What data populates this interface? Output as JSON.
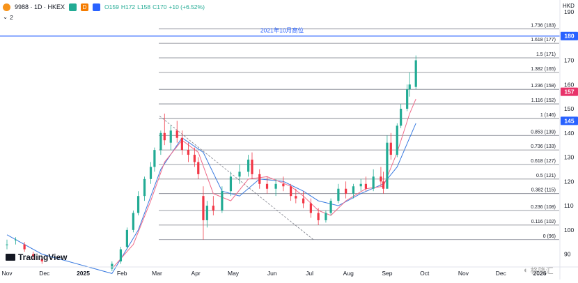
{
  "header": {
    "symbol": "9988 · 1D · HKEX",
    "badge_d": "D",
    "ohlc": [
      "O159",
      "H172",
      "L158",
      "C170"
    ],
    "change": "+10 (+6.52%)",
    "layers": "2",
    "currency": "HKD",
    "chevron": "chevron-down-icon"
  },
  "watermark": "TradingView",
  "watermark_secondary": "格隆汇",
  "colors": {
    "up": "#22ab94",
    "down": "#f23645",
    "ma_fast": "#f06b8a",
    "ma_slow": "#3a7be0",
    "fib": "#787b86",
    "resistance": "#2962ff",
    "label_157": "#e8336a",
    "label_145": "#2962ff"
  },
  "chart_data": {
    "type": "candlestick",
    "y_axis": {
      "min": 85,
      "max": 192,
      "ticks": [
        90,
        100,
        110,
        120,
        130,
        140,
        150,
        160,
        170,
        180,
        190
      ]
    },
    "x_axis_labels": [
      "Nov",
      "Dec",
      "2025",
      "Feb",
      "Mar",
      "Apr",
      "May",
      "Jun",
      "Jul",
      "Aug",
      "Sep",
      "Oct",
      "Nov",
      "Dec",
      "2026"
    ],
    "fibonacci": [
      {
        "ratio": "0",
        "price": 96
      },
      {
        "ratio": "0.116",
        "price": 102
      },
      {
        "ratio": "0.236",
        "price": 108
      },
      {
        "ratio": "0.382",
        "price": 115
      },
      {
        "ratio": "0.5",
        "price": 121
      },
      {
        "ratio": "0.618",
        "price": 127
      },
      {
        "ratio": "0.736",
        "price": 133
      },
      {
        "ratio": "0.853",
        "price": 139
      },
      {
        "ratio": "1",
        "price": 146
      },
      {
        "ratio": "1.116",
        "price": 152
      },
      {
        "ratio": "1.236",
        "price": 158
      },
      {
        "ratio": "1.382",
        "price": 165
      },
      {
        "ratio": "1.5",
        "price": 171
      },
      {
        "ratio": "1.618",
        "price": 177
      },
      {
        "ratio": "1.736",
        "price": 183
      }
    ],
    "resistance": {
      "price": 180,
      "label": "2021年10月高位"
    },
    "price_labels": [
      {
        "price": 180,
        "text": "180"
      },
      {
        "price": 157,
        "text": "157"
      },
      {
        "price": 145,
        "text": "145"
      }
    ],
    "trendline": {
      "from": [
        "2025-03-03",
        147
      ],
      "to": [
        "2025-07-04",
        96
      ]
    },
    "candles": [
      [
        "2024-11-01",
        94,
        96,
        92,
        94
      ],
      [
        "2024-11-08",
        96,
        97,
        94,
        96
      ],
      [
        "2024-11-15",
        94,
        95,
        91,
        92
      ],
      [
        "2024-11-22",
        90,
        91,
        88,
        89
      ],
      [
        "2024-11-29",
        88,
        89,
        86,
        87
      ],
      [
        "2025-01-24",
        84,
        87,
        83,
        86
      ],
      [
        "2025-01-31",
        87,
        93,
        86,
        92
      ],
      [
        "2025-02-05",
        93,
        101,
        92,
        100
      ],
      [
        "2025-02-10",
        100,
        108,
        99,
        107
      ],
      [
        "2025-02-14",
        107,
        116,
        106,
        114
      ],
      [
        "2025-02-19",
        114,
        122,
        112,
        121
      ],
      [
        "2025-02-24",
        121,
        128,
        119,
        126
      ],
      [
        "2025-02-27",
        126,
        134,
        124,
        133
      ],
      [
        "2025-03-04",
        133,
        141,
        131,
        140
      ],
      [
        "2025-03-07",
        140,
        148,
        135,
        137
      ],
      [
        "2025-03-12",
        136,
        143,
        133,
        141
      ],
      [
        "2025-03-17",
        141,
        145,
        136,
        138
      ],
      [
        "2025-03-21",
        138,
        141,
        131,
        133
      ],
      [
        "2025-03-26",
        133,
        136,
        128,
        131
      ],
      [
        "2025-03-31",
        131,
        134,
        126,
        128
      ],
      [
        "2025-04-03",
        128,
        130,
        121,
        123
      ],
      [
        "2025-04-07",
        114,
        118,
        96,
        104
      ],
      [
        "2025-04-10",
        104,
        112,
        101,
        110
      ],
      [
        "2025-04-15",
        110,
        114,
        106,
        108
      ],
      [
        "2025-04-22",
        108,
        118,
        107,
        116
      ],
      [
        "2025-04-29",
        116,
        124,
        114,
        122
      ],
      [
        "2025-05-06",
        122,
        127,
        119,
        124
      ],
      [
        "2025-05-13",
        124,
        131,
        122,
        129
      ],
      [
        "2025-05-16",
        129,
        132,
        121,
        123
      ],
      [
        "2025-05-22",
        123,
        125,
        117,
        119
      ],
      [
        "2025-05-28",
        119,
        122,
        115,
        117
      ],
      [
        "2025-06-04",
        117,
        121,
        114,
        119
      ],
      [
        "2025-06-10",
        119,
        122,
        116,
        118
      ],
      [
        "2025-06-16",
        118,
        119,
        112,
        114
      ],
      [
        "2025-06-20",
        114,
        117,
        111,
        113
      ],
      [
        "2025-06-26",
        113,
        116,
        109,
        111
      ],
      [
        "2025-07-02",
        111,
        113,
        105,
        107
      ],
      [
        "2025-07-08",
        107,
        109,
        102,
        104
      ],
      [
        "2025-07-14",
        104,
        108,
        103,
        107
      ],
      [
        "2025-07-18",
        107,
        113,
        106,
        112
      ],
      [
        "2025-07-24",
        112,
        119,
        111,
        117
      ],
      [
        "2025-07-30",
        117,
        120,
        113,
        115
      ],
      [
        "2025-08-05",
        115,
        119,
        113,
        118
      ],
      [
        "2025-08-11",
        118,
        121,
        116,
        119
      ],
      [
        "2025-08-15",
        119,
        122,
        116,
        117
      ],
      [
        "2025-08-21",
        117,
        125,
        116,
        122
      ],
      [
        "2025-08-27",
        122,
        126,
        118,
        120
      ],
      [
        "2025-08-29",
        120,
        124,
        115,
        117
      ],
      [
        "2025-09-01",
        117,
        139,
        117,
        136
      ],
      [
        "2025-09-04",
        136,
        140,
        129,
        131
      ],
      [
        "2025-09-09",
        131,
        144,
        130,
        143
      ],
      [
        "2025-09-12",
        143,
        152,
        142,
        150
      ],
      [
        "2025-09-17",
        150,
        160,
        149,
        158
      ],
      [
        "2025-09-19",
        158,
        165,
        155,
        160
      ],
      [
        "2025-09-24",
        159,
        172,
        158,
        170
      ]
    ],
    "ma_fast": [
      [
        "2025-01-24",
        84
      ],
      [
        "2025-02-10",
        94
      ],
      [
        "2025-02-24",
        112
      ],
      [
        "2025-03-07",
        128
      ],
      [
        "2025-03-21",
        137
      ],
      [
        "2025-04-03",
        132
      ],
      [
        "2025-04-15",
        115
      ],
      [
        "2025-04-29",
        112
      ],
      [
        "2025-05-13",
        121
      ],
      [
        "2025-05-28",
        122
      ],
      [
        "2025-06-16",
        118
      ],
      [
        "2025-06-26",
        114
      ],
      [
        "2025-07-08",
        108
      ],
      [
        "2025-07-18",
        106
      ],
      [
        "2025-07-30",
        112
      ],
      [
        "2025-08-15",
        117
      ],
      [
        "2025-08-29",
        118
      ],
      [
        "2025-09-09",
        132
      ],
      [
        "2025-09-19",
        148
      ],
      [
        "2025-09-24",
        154
      ]
    ],
    "ma_slow": [
      [
        "2024-11-01",
        98
      ],
      [
        "2024-11-29",
        90
      ],
      [
        "2025-01-24",
        82
      ],
      [
        "2025-02-14",
        100
      ],
      [
        "2025-03-04",
        125
      ],
      [
        "2025-03-21",
        138
      ],
      [
        "2025-04-07",
        132
      ],
      [
        "2025-04-22",
        116
      ],
      [
        "2025-05-06",
        114
      ],
      [
        "2025-05-22",
        121
      ],
      [
        "2025-06-10",
        120
      ],
      [
        "2025-06-26",
        116
      ],
      [
        "2025-07-08",
        112
      ],
      [
        "2025-07-24",
        110
      ],
      [
        "2025-08-11",
        115
      ],
      [
        "2025-08-29",
        119
      ],
      [
        "2025-09-09",
        126
      ],
      [
        "2025-09-19",
        138
      ],
      [
        "2025-09-24",
        144
      ]
    ]
  }
}
